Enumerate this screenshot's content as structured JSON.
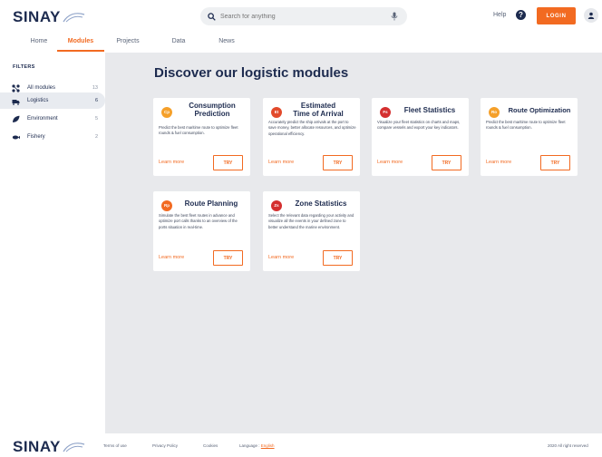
{
  "brand": {
    "name": "SINAY"
  },
  "search": {
    "placeholder": "Search for anything"
  },
  "header": {
    "help_label": "Help",
    "help_glyph": "?",
    "login_label": "LOGIN"
  },
  "tabs": [
    {
      "label": "Home"
    },
    {
      "label": "Modules",
      "active": true
    },
    {
      "label": "Projects"
    },
    {
      "label": "Data"
    },
    {
      "label": "News"
    }
  ],
  "sidebar": {
    "title": "FILTERS",
    "items": [
      {
        "label": "All modules",
        "count": "13",
        "icon": "all-modules-icon"
      },
      {
        "label": "Logistics",
        "count": "6",
        "icon": "logistics-icon",
        "active": true
      },
      {
        "label": "Environment",
        "count": "5",
        "icon": "environment-icon"
      },
      {
        "label": "Fishery",
        "count": "2",
        "icon": "fishery-icon"
      }
    ]
  },
  "main": {
    "title": "Discover our logistic modules"
  },
  "cards": [
    {
      "badge": "Cp",
      "badge_color": "#f5a02a",
      "title_line1": "Consumption",
      "title_line2": "Prediction",
      "description": "Predict the best maritime route to optimize fleet rounds & fuel consumption.",
      "learn_more": "Learn more",
      "try": "TRY"
    },
    {
      "badge": "Et",
      "badge_color": "#e24a2b",
      "title_line1": "Estimated",
      "title_line2": "Time of Arrival",
      "description": "Accurately predict the ship arrivals at the port to save money, better allocate resources, and optimize operational efficiency.",
      "learn_more": "Learn more",
      "try": "TRY"
    },
    {
      "badge": "Fs",
      "badge_color": "#d42f2f",
      "title_line1": "Fleet Statistics",
      "title_line2": "",
      "description": "Visualize your fleet statistics on charts and maps, compare vessels and export your key indicators.",
      "learn_more": "Learn more",
      "try": "TRY"
    },
    {
      "badge": "Ro",
      "badge_color": "#f5a02a",
      "title_line1": "Route Optimization",
      "title_line2": "",
      "description": "Predict the best maritime route to optimize fleet rounds & fuel consumption.",
      "learn_more": "Learn more",
      "try": "TRY"
    },
    {
      "badge": "Rp",
      "badge_color": "#f26a21",
      "title_line1": "Route Planning",
      "title_line2": "",
      "description": "Simulate the best fleet routes in advance and optimize port calls thanks to an overview of the ports situation in real-time.",
      "learn_more": "Learn more",
      "try": "TRY"
    },
    {
      "badge": "Zs",
      "badge_color": "#d42f2f",
      "title_line1": "Zone Statistics",
      "title_line2": "",
      "description": "Select the relevant data regarding your activity and visualize all the events in your defined zone to better understand the marine environment.",
      "learn_more": "Learn more",
      "try": "TRY"
    }
  ],
  "footer": {
    "brand": "SINAY",
    "terms": "Terms of use",
    "privacy": "Privacy Policy",
    "cookies": "Cookies",
    "language_label": "Language :",
    "language_value": "English",
    "copyright": "2020 All right reserved"
  },
  "colors": {
    "accent": "#f26a21",
    "navy": "#1d2b4f",
    "main_bg": "#e8e9ec"
  }
}
